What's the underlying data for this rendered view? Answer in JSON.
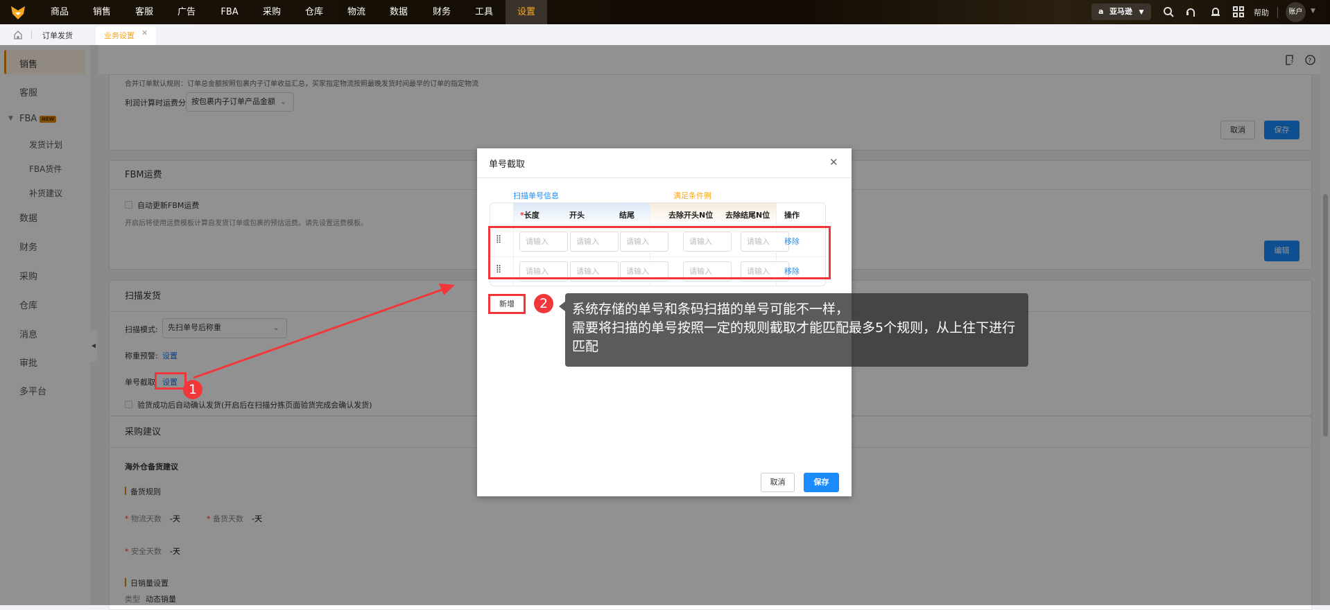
{
  "topnav": {
    "items": [
      "商品",
      "销售",
      "客服",
      "广告",
      "FBA",
      "采购",
      "仓库",
      "物流",
      "数据",
      "财务",
      "工具",
      "设置"
    ],
    "active": "设置",
    "platform": "亚马逊",
    "help": "帮助",
    "account": "账户"
  },
  "tabs": {
    "items": [
      "订单发货",
      "业务设置"
    ],
    "active": "业务设置"
  },
  "sidebar": {
    "items": [
      "销售",
      "客服",
      "FBA",
      "发货计划",
      "FBA货件",
      "补货建议",
      "数据",
      "财务",
      "采购",
      "仓库",
      "消息",
      "审批",
      "多平台"
    ],
    "new_badge": "NEW",
    "active": "销售"
  },
  "panel_order": {
    "rule_text": "合并订单默认规则：订单总金额按照包裹内子订单收益汇总，买家指定物流按照最晚发货时间最早的订单的指定物流",
    "freight_label": "利润计算时运费分摊:",
    "freight_value": "按包裹内子订单产品金额",
    "cancel": "取消",
    "save": "保存"
  },
  "panel_fbm": {
    "title": "FBM运费",
    "checkbox_label": "自动更新FBM运费",
    "desc": "开启后将使用运费模板计算自发货订单或包裹的预估运费。请先设置运费模板。",
    "edit": "编辑"
  },
  "panel_scan": {
    "title": "扫描发货",
    "mode_label": "扫描模式:",
    "mode_value": "先扫单号后称重",
    "weight_label": "称重预警:",
    "weight_link": "设置",
    "cut_label": "单号截取",
    "cut_link": "设置",
    "confirm_label": "验货成功后自动确认发货(开启后在扫描分拣页面验货完成会确认发货)"
  },
  "panel_purchase": {
    "title": "采购建议",
    "subtitle": "海外仓备货建议",
    "rule_title": "备货规则",
    "logistics_days_label": "物流天数",
    "logistics_days": "-天",
    "stock_days_label": "备货天数",
    "stock_days": "-天",
    "safety_days_label": "安全天数",
    "safety_days": "-天",
    "daily_title": "日销量设置",
    "type_label": "类型",
    "type_value": "动态销量"
  },
  "dialog": {
    "title": "单号截取",
    "group_scan": "扫描单号信息",
    "group_cond": "满足条件则",
    "columns": [
      "长度",
      "开头",
      "结尾",
      "去除开头N位",
      "去除结尾N位",
      "操作"
    ],
    "required_mark": "*",
    "placeholder": "请输入",
    "rows": [
      {
        "remove": "移除"
      },
      {
        "remove": "移除"
      }
    ],
    "add": "新增",
    "cancel": "取消",
    "save": "保存"
  },
  "annotations": {
    "step1": "1",
    "step2": "2",
    "tooltip_line1": "系统存储的单号和条码扫描的单号可能不一样，",
    "tooltip_line2": "需要将扫描的单号按照一定的规则截取才能匹配最多5个规则，从上往下进行匹配"
  },
  "colors": {
    "accent": "#f5a623",
    "primary": "#1a8cff",
    "annotation": "#f2373a"
  }
}
